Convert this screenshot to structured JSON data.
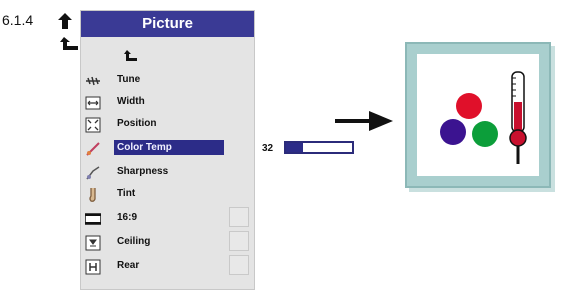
{
  "section_number": "6.1.4",
  "menu": {
    "title": "Picture",
    "items": [
      {
        "label": "Tune",
        "icon": "tune-icon"
      },
      {
        "label": "Width",
        "icon": "width-icon"
      },
      {
        "label": "Position",
        "icon": "position-icon"
      },
      {
        "label": "Color Temp",
        "icon": "color-temp-icon",
        "selected": true
      },
      {
        "label": "Sharpness",
        "icon": "sharpness-icon"
      },
      {
        "label": "Tint",
        "icon": "tint-icon"
      },
      {
        "label": "16:9",
        "icon": "aspect-16-9-icon"
      },
      {
        "label": "Ceiling",
        "icon": "ceiling-icon"
      },
      {
        "label": "Rear",
        "icon": "rear-icon"
      }
    ]
  },
  "slider": {
    "value_label": "32",
    "fraction": 0.25
  },
  "colors": {
    "title_bar": "#3a3a95",
    "highlight": "#2c2c88",
    "panel": "#e4e4e4",
    "card_border": "#a9cfce",
    "dot_red": "#e0102a",
    "dot_purple": "#3b1390",
    "dot_green": "#0c9e3a",
    "thermo_red": "#c8102e"
  }
}
